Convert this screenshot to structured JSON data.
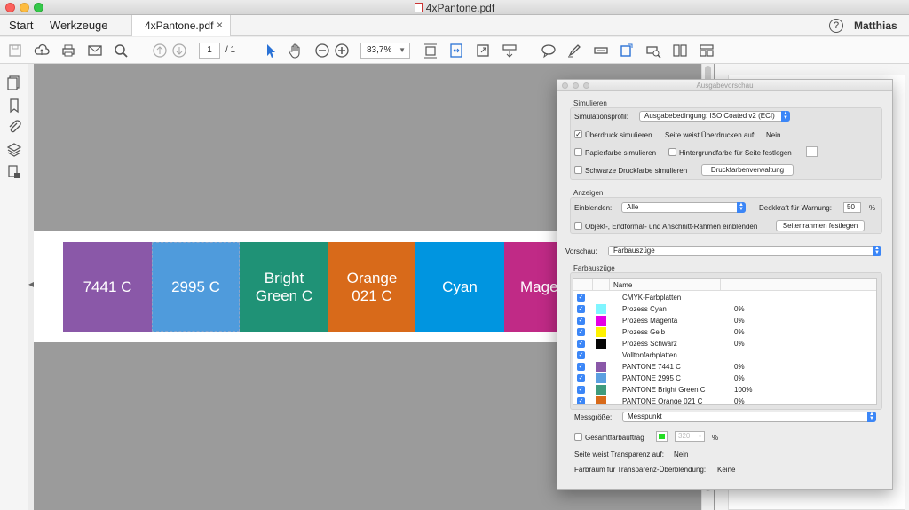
{
  "window": {
    "title": "4xPantone.pdf"
  },
  "tabs": {
    "start": "Start",
    "tools": "Werkzeuge",
    "document": "4xPantone.pdf",
    "close": "×"
  },
  "header": {
    "help": "?",
    "user": "Matthias"
  },
  "toolbar": {
    "page_current": "1",
    "page_total": "/ 1",
    "zoom": "83,7%",
    "icons": [
      "save-icon",
      "upload-icon",
      "print-icon",
      "mail-icon",
      "search-icon",
      "page-up-icon",
      "page-down-icon",
      "select-arrow-icon",
      "hand-icon",
      "zoom-out-icon",
      "zoom-in-icon",
      "fit-page-icon",
      "fit-width-icon",
      "fullscreen-icon",
      "scroll-mode-icon",
      "comment-icon",
      "pen-icon",
      "highlight-icon",
      "stamp-icon",
      "print-preview-icon",
      "compare-icon",
      "more-tools-icon"
    ]
  },
  "sidebar": {
    "icons": [
      "pages-icon",
      "bookmark-icon",
      "attachment-icon",
      "layers-icon",
      "lock-page-icon"
    ]
  },
  "document": {
    "swatches": [
      {
        "label": "7441 C",
        "color": "#8a58a8"
      },
      {
        "label": "2995 C",
        "color": "#4f9bdc"
      },
      {
        "label": "Bright\nGreen C",
        "color": "#1f9276"
      },
      {
        "label": "Orange\n021 C",
        "color": "#d86a1a"
      },
      {
        "label": "Cyan",
        "color": "#0095e0"
      },
      {
        "label": "Magenta",
        "color": "#c02a86"
      }
    ]
  },
  "dialog": {
    "title": "Ausgabevorschau",
    "simulate": {
      "section": "Simulieren",
      "profile_label": "Simulationsprofil:",
      "profile_value": "Ausgabebedingung: ISO Coated v2 (ECI)",
      "overprint_label": "Überdruck simulieren",
      "overprint_checked": true,
      "page_overprint_label": "Seite weist Überdrucken auf:",
      "page_overprint_value": "Nein",
      "paper_label": "Papierfarbe simulieren",
      "paper_checked": false,
      "background_label": "Hintergrundfarbe für Seite festlegen",
      "background_checked": false,
      "black_label": "Schwarze Druckfarbe simulieren",
      "black_checked": false,
      "ink_manager_button": "Druckfarbenverwaltung"
    },
    "display": {
      "section": "Anzeigen",
      "show_label": "Einblenden:",
      "show_value": "Alle",
      "opacity_label": "Deckkraft für Warnung:",
      "opacity_value": "50",
      "opacity_unit": "%",
      "boxes_label": "Objekt-, Endformat- und Anschnitt-Rahmen einblenden",
      "boxes_checked": false,
      "page_boxes_button": "Seitenrahmen festlegen"
    },
    "preview_label": "Vorschau:",
    "preview_value": "Farbauszüge",
    "separations": {
      "section": "Farbauszüge",
      "column_name": "Name",
      "rows": [
        {
          "name": "CMYK-Farbplatten",
          "percent": "",
          "color": ""
        },
        {
          "name": "Prozess Cyan",
          "percent": "0%",
          "color": "#7ff5ff"
        },
        {
          "name": "Prozess Magenta",
          "percent": "0%",
          "color": "#e400e6"
        },
        {
          "name": "Prozess Gelb",
          "percent": "0%",
          "color": "#fff200"
        },
        {
          "name": "Prozess Schwarz",
          "percent": "0%",
          "color": "#050505"
        },
        {
          "name": "Volltonfarbplatten",
          "percent": "",
          "color": ""
        },
        {
          "name": "PANTONE 7441 C",
          "percent": "0%",
          "color": "#8a58a8"
        },
        {
          "name": "PANTONE 2995 C",
          "percent": "0%",
          "color": "#5b9fe0"
        },
        {
          "name": "PANTONE Bright Green C",
          "percent": "100%",
          "color": "#3f9b7d"
        },
        {
          "name": "PANTONE Orange 021 C",
          "percent": "0%",
          "color": "#d86a1a"
        }
      ]
    },
    "sample_label": "Messgröße:",
    "sample_value": "Messpunkt",
    "total_ink_label": "Gesamtfarbauftrag",
    "total_ink_checked": false,
    "total_ink_color": "#22dd22",
    "total_ink_value": "320",
    "total_ink_unit": "%",
    "transparency_label": "Seite weist Transparenz auf:",
    "transparency_value": "Nein",
    "blend_space_label": "Farbraum für Transparenz-Überblendung:",
    "blend_space_value": "Keine"
  }
}
